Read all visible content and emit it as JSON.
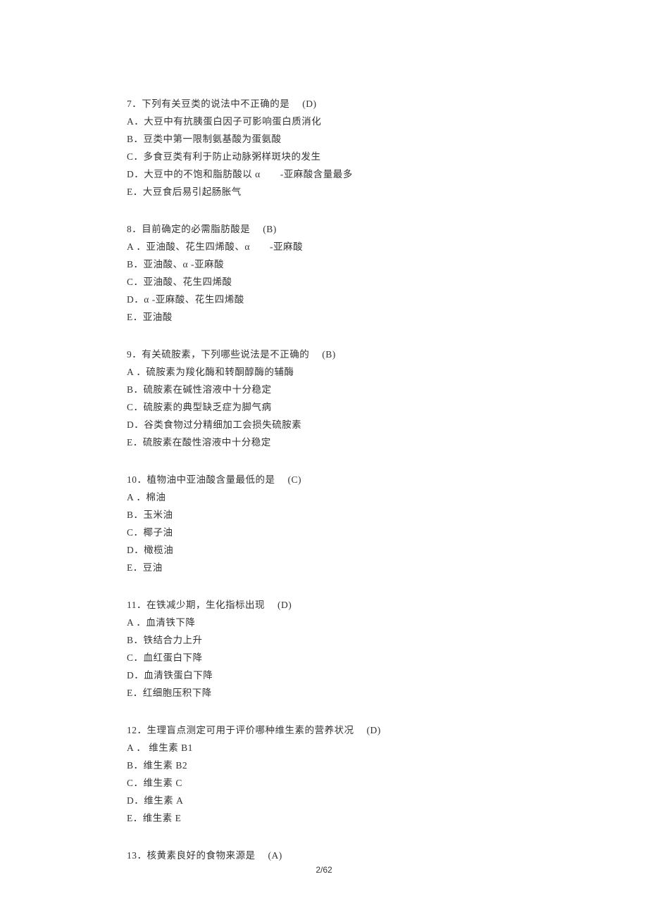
{
  "questions": [
    {
      "number": "7",
      "stem": "下列有关豆类的说法中不正确的是",
      "answer": "(D)",
      "options": [
        {
          "label": "A",
          "text": "大豆中有抗胰蛋白因子可影响蛋白质消化"
        },
        {
          "label": "B",
          "text": "豆类中第一限制氨基酸为蛋氨酸"
        },
        {
          "label": "C",
          "text": "多食豆类有利于防止动脉粥样斑块的发生"
        },
        {
          "label": "D",
          "text_parts": [
            "大豆中的不饱和脂肪酸以 α",
            "-亚麻酸含量最多"
          ]
        },
        {
          "label": "E",
          "text": "大豆食后易引起肠胀气"
        }
      ]
    },
    {
      "number": "8",
      "stem": "目前确定的必需脂肪酸是",
      "answer": "(B)",
      "options": [
        {
          "label": "A",
          "text_parts": [
            "亚油酸、花生四烯酸、α",
            "-亚麻酸"
          ]
        },
        {
          "label": "B",
          "text": "亚油酸、α -亚麻酸"
        },
        {
          "label": "C",
          "text": "亚油酸、花生四烯酸"
        },
        {
          "label": "D",
          "text": "α -亚麻酸、花生四烯酸"
        },
        {
          "label": "E",
          "text": "亚油酸"
        }
      ]
    },
    {
      "number": "9",
      "stem": "有关硫胺素，下列哪些说法是不正确的",
      "answer": "(B)",
      "options": [
        {
          "label": "A",
          "text": "硫胺素为羧化酶和转酮醇酶的辅酶"
        },
        {
          "label": "B",
          "text": "硫胺素在碱性溶液中十分稳定"
        },
        {
          "label": "C",
          "text": "硫胺素的典型缺乏症为脚气病"
        },
        {
          "label": "D",
          "text": "谷类食物过分精细加工会损失硫胺素"
        },
        {
          "label": "E",
          "text": "硫胺素在酸性溶液中十分稳定"
        }
      ]
    },
    {
      "number": "10",
      "stem": "植物油中亚油酸含量最低的是",
      "answer": "(C)",
      "options": [
        {
          "label": "A",
          "text": "棉油"
        },
        {
          "label": "B",
          "text": "玉米油"
        },
        {
          "label": "C",
          "text": "椰子油"
        },
        {
          "label": "D",
          "text": "橄榄油"
        },
        {
          "label": "E",
          "text": "豆油"
        }
      ]
    },
    {
      "number": "11",
      "stem": "在铁减少期，生化指标出现",
      "answer": "(D)",
      "options": [
        {
          "label": "A",
          "text": "血清铁下降"
        },
        {
          "label": "B",
          "text": "铁结合力上升"
        },
        {
          "label": "C",
          "text": "血红蛋白下降"
        },
        {
          "label": "D",
          "text": "血清铁蛋白下降"
        },
        {
          "label": "E",
          "text": "红细胞压积下降"
        }
      ]
    },
    {
      "number": "12",
      "stem": "生理盲点测定可用于评价哪种维生素的营养状况",
      "answer": "(D)",
      "options": [
        {
          "label": "A",
          "text": "维生素  B1"
        },
        {
          "label": "B",
          "text": "维生素  B2"
        },
        {
          "label": "C",
          "text": "维生素  C"
        },
        {
          "label": "D",
          "text": "维生素  A"
        },
        {
          "label": "E",
          "text": "维生素  E"
        }
      ]
    },
    {
      "number": "13",
      "stem": "核黄素良好的食物来源是",
      "answer": "(A)",
      "options": []
    }
  ],
  "footer": "2/62"
}
